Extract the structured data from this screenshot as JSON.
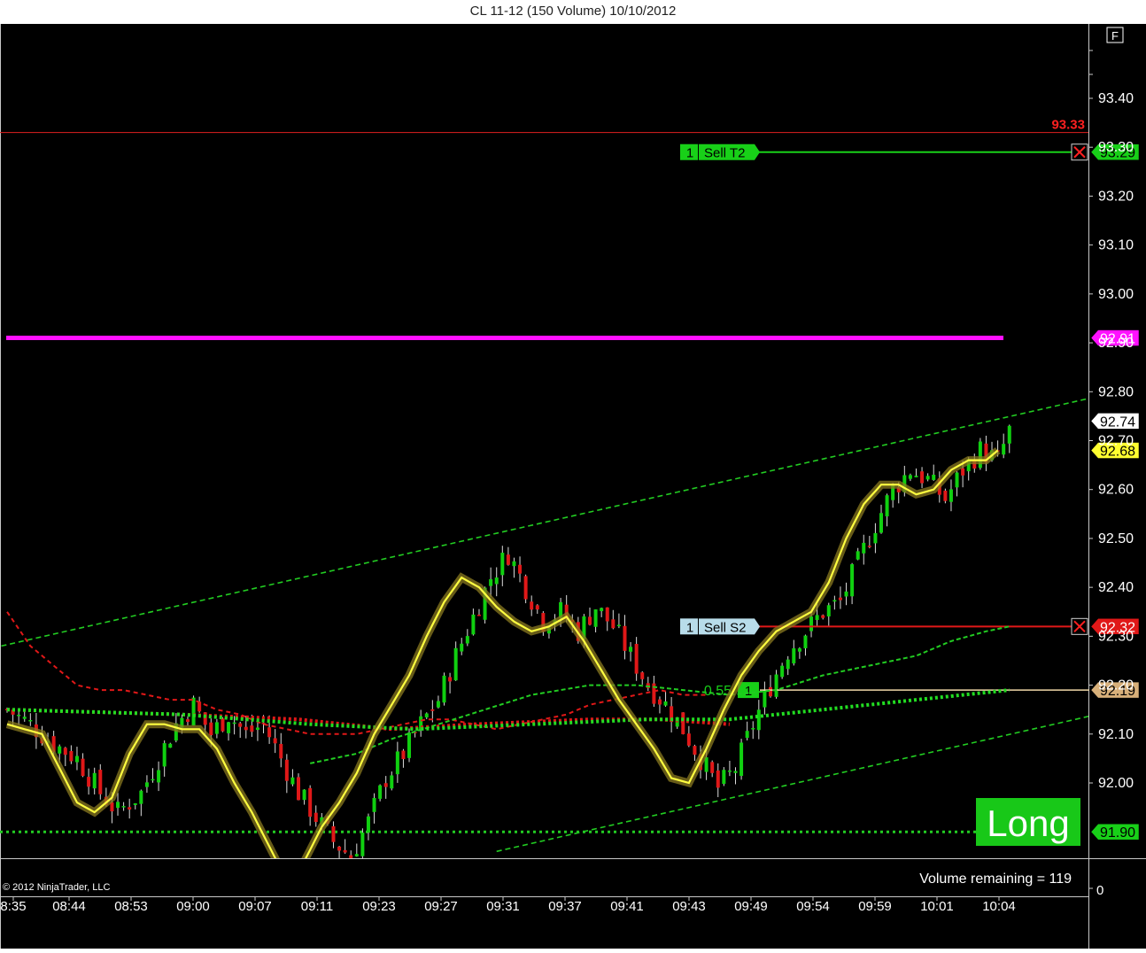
{
  "window": {
    "title": "CL 11-12 (150 Volume)  10/10/2012"
  },
  "chart_data": {
    "type": "candlestick",
    "instrument": "CL 11-12",
    "bar_type": "150 Volume",
    "date": "10/10/2012",
    "ylim": [
      91.84,
      93.52
    ],
    "y_ticks": [
      "93.40",
      "93.30",
      "93.20",
      "93.10",
      "93.00",
      "92.90",
      "92.80",
      "92.70",
      "92.60",
      "92.50",
      "92.40",
      "92.30",
      "92.20",
      "92.10",
      "92.00"
    ],
    "x_ticks": [
      "8:35",
      "08:44",
      "08:53",
      "09:00",
      "09:07",
      "09:11",
      "09:23",
      "09:27",
      "09:31",
      "09:37",
      "09:41",
      "09:43",
      "09:49",
      "09:54",
      "09:59",
      "10:01",
      "10:04"
    ],
    "close_path": [
      [
        0,
        92.15
      ],
      [
        4,
        92.12
      ],
      [
        8,
        92.08
      ],
      [
        12,
        92.05
      ],
      [
        16,
        91.98
      ],
      [
        19,
        91.94
      ],
      [
        23,
        91.98
      ],
      [
        26,
        92.05
      ],
      [
        29,
        92.12
      ],
      [
        32,
        92.16
      ],
      [
        35,
        92.1
      ],
      [
        38,
        92.14
      ],
      [
        41,
        92.1
      ],
      [
        44,
        92.12
      ],
      [
        47,
        92.05
      ],
      [
        50,
        91.98
      ],
      [
        53,
        91.93
      ],
      [
        56,
        91.88
      ],
      [
        59,
        91.85
      ],
      [
        62,
        91.92
      ],
      [
        65,
        92.01
      ],
      [
        68,
        92.06
      ],
      [
        71,
        92.12
      ],
      [
        74,
        92.17
      ],
      [
        77,
        92.26
      ],
      [
        80,
        92.34
      ],
      [
        83,
        92.42
      ],
      [
        86,
        92.47
      ],
      [
        89,
        92.4
      ],
      [
        92,
        92.33
      ],
      [
        95,
        92.35
      ],
      [
        98,
        92.31
      ],
      [
        101,
        92.36
      ],
      [
        104,
        92.32
      ],
      [
        107,
        92.26
      ],
      [
        110,
        92.2
      ],
      [
        113,
        92.16
      ],
      [
        116,
        92.11
      ],
      [
        119,
        92.05
      ],
      [
        122,
        91.99
      ],
      [
        125,
        92.03
      ],
      [
        128,
        92.12
      ],
      [
        131,
        92.2
      ],
      [
        134,
        92.27
      ],
      [
        137,
        92.31
      ],
      [
        140,
        92.35
      ],
      [
        143,
        92.37
      ],
      [
        146,
        92.45
      ],
      [
        149,
        92.53
      ],
      [
        152,
        92.6
      ],
      [
        155,
        92.64
      ],
      [
        158,
        92.62
      ],
      [
        161,
        92.58
      ],
      [
        164,
        92.64
      ],
      [
        167,
        92.68
      ],
      [
        170,
        92.66
      ],
      [
        172,
        92.72
      ]
    ],
    "ma_yellow": [
      [
        0,
        92.12
      ],
      [
        3,
        92.11
      ],
      [
        6,
        92.1
      ],
      [
        9,
        92.03
      ],
      [
        12,
        91.96
      ],
      [
        15,
        91.94
      ],
      [
        18,
        91.97
      ],
      [
        21,
        92.06
      ],
      [
        24,
        92.12
      ],
      [
        27,
        92.12
      ],
      [
        30,
        92.11
      ],
      [
        33,
        92.11
      ],
      [
        36,
        92.07
      ],
      [
        39,
        92.0
      ],
      [
        42,
        91.94
      ],
      [
        45,
        91.87
      ],
      [
        48,
        91.8
      ],
      [
        51,
        91.84
      ],
      [
        54,
        91.91
      ],
      [
        57,
        91.96
      ],
      [
        60,
        92.02
      ],
      [
        63,
        92.1
      ],
      [
        66,
        92.16
      ],
      [
        69,
        92.22
      ],
      [
        72,
        92.3
      ],
      [
        75,
        92.37
      ],
      [
        78,
        92.42
      ],
      [
        81,
        92.4
      ],
      [
        84,
        92.36
      ],
      [
        87,
        92.33
      ],
      [
        90,
        92.31
      ],
      [
        93,
        92.32
      ],
      [
        96,
        92.34
      ],
      [
        99,
        92.29
      ],
      [
        102,
        92.23
      ],
      [
        105,
        92.17
      ],
      [
        108,
        92.12
      ],
      [
        111,
        92.07
      ],
      [
        114,
        92.01
      ],
      [
        117,
        92.0
      ],
      [
        120,
        92.07
      ],
      [
        123,
        92.15
      ],
      [
        126,
        92.22
      ],
      [
        129,
        92.27
      ],
      [
        132,
        92.31
      ],
      [
        135,
        92.33
      ],
      [
        138,
        92.35
      ],
      [
        141,
        92.41
      ],
      [
        144,
        92.5
      ],
      [
        147,
        92.57
      ],
      [
        150,
        92.61
      ],
      [
        153,
        92.61
      ],
      [
        156,
        92.59
      ],
      [
        159,
        92.6
      ],
      [
        162,
        92.64
      ],
      [
        165,
        92.66
      ],
      [
        168,
        92.66
      ],
      [
        170,
        92.68
      ]
    ],
    "upper_channel": {
      "from": [
        -1,
        92.28
      ],
      "to": [
        187,
        92.79
      ],
      "color": "#22cc22"
    },
    "lower_channel": {
      "from": [
        84,
        91.86
      ],
      "to": [
        187,
        92.14
      ],
      "color": "#22cc22"
    },
    "red_dotted_ma": [
      [
        0,
        92.35
      ],
      [
        4,
        92.28
      ],
      [
        8,
        92.24
      ],
      [
        12,
        92.2
      ],
      [
        16,
        92.19
      ],
      [
        20,
        92.19
      ],
      [
        24,
        92.18
      ],
      [
        28,
        92.17
      ],
      [
        32,
        92.17
      ],
      [
        36,
        92.15
      ],
      [
        40,
        92.14
      ],
      [
        44,
        92.12
      ],
      [
        48,
        92.11
      ],
      [
        52,
        92.1
      ],
      [
        56,
        92.1
      ],
      [
        60,
        92.1
      ],
      [
        64,
        92.11
      ],
      [
        68,
        92.12
      ],
      [
        72,
        92.13
      ],
      [
        76,
        92.13
      ],
      [
        80,
        92.12
      ],
      [
        84,
        92.11
      ],
      [
        88,
        92.12
      ],
      [
        92,
        92.13
      ],
      [
        96,
        92.14
      ],
      [
        100,
        92.16
      ],
      [
        104,
        92.17
      ],
      [
        108,
        92.18
      ],
      [
        112,
        92.19
      ],
      [
        116,
        92.18
      ],
      [
        120,
        92.18
      ]
    ],
    "red_thick_ma": [
      [
        0,
        92.15
      ],
      [
        30,
        92.14
      ],
      [
        50,
        92.13
      ],
      [
        66,
        92.11
      ],
      [
        80,
        92.12
      ],
      [
        100,
        92.13
      ],
      [
        112,
        92.13
      ],
      [
        124,
        92.12
      ]
    ],
    "green_thin_ma": [
      [
        52,
        92.04
      ],
      [
        60,
        92.06
      ],
      [
        66,
        92.09
      ],
      [
        74,
        92.12
      ],
      [
        82,
        92.15
      ],
      [
        90,
        92.18
      ],
      [
        100,
        92.2
      ],
      [
        108,
        92.2
      ],
      [
        116,
        92.19
      ],
      [
        124,
        92.18
      ],
      [
        132,
        92.19
      ],
      [
        140,
        92.22
      ],
      [
        148,
        92.24
      ],
      [
        156,
        92.26
      ],
      [
        162,
        92.29
      ],
      [
        168,
        92.31
      ],
      [
        172,
        92.32
      ]
    ],
    "green_thick_ma": [
      [
        0,
        92.15
      ],
      [
        30,
        92.14
      ],
      [
        52,
        92.12
      ],
      [
        70,
        92.11
      ],
      [
        90,
        92.12
      ],
      [
        110,
        92.13
      ],
      [
        124,
        92.13
      ],
      [
        140,
        92.15
      ],
      [
        156,
        92.17
      ],
      [
        172,
        92.19
      ]
    ],
    "green_dotted_level": 91.9,
    "levels": [
      {
        "value": 93.33,
        "label": "93.33",
        "color": "#ff2020"
      },
      {
        "value": 92.91,
        "label": "92.91",
        "color": "#ff10ff"
      },
      {
        "value": 91.9,
        "label": "91.90",
        "color": "#22cc22"
      }
    ],
    "orders": [
      {
        "qty": "1",
        "name": "Sell T2",
        "price": 93.29,
        "price_label": "93.29",
        "color": "#22e022"
      },
      {
        "qty": "1",
        "name": "Sell S2",
        "price": 92.32,
        "price_label": "92.32",
        "color": "#ff2020"
      }
    ],
    "position": {
      "qty": "1",
      "pnl": "0.55",
      "price": 92.19,
      "price_label": "92.19"
    },
    "price_markers": [
      {
        "value": 92.74,
        "label": "92.74",
        "bg": "#ffffff",
        "fg": "#000000"
      },
      {
        "value": 92.68,
        "label": "92.68",
        "bg": "#ffff30",
        "fg": "#000000"
      }
    ],
    "signal": "Long",
    "volume_remaining": "Volume remaining = 119",
    "volume_axis_label": "0",
    "copyright": "© 2012 NinjaTrader, LLC",
    "flag_button": "F"
  }
}
